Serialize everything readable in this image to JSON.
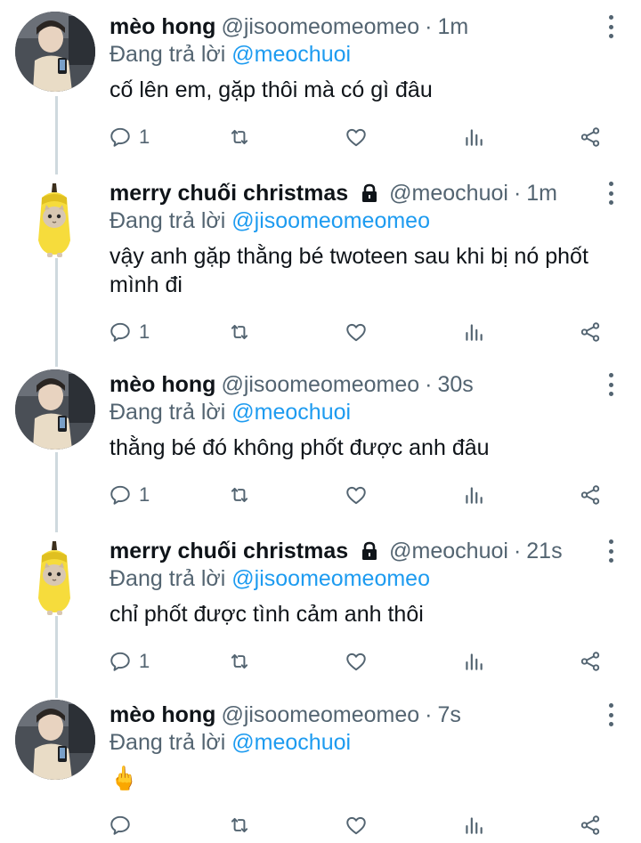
{
  "replying_prefix": "Đang trả lời ",
  "tweets": [
    {
      "name": "mèo hong",
      "handle": "@jisoomeomeomeo",
      "separator": "·",
      "time": "1m",
      "reply_to": "@meochuoi",
      "text": "cố lên em, gặp thôi mà có gì đâu",
      "reply_count": "1",
      "avatar": "person-photo",
      "locked": false
    },
    {
      "name": "merry chuối christmas",
      "handle": "@meochuoi",
      "separator": "·",
      "time": "1m",
      "reply_to": "@jisoomeomeomeo",
      "text": "vậy anh gặp thằng bé twoteen sau khi bị nó phốt mình đi",
      "reply_count": "1",
      "avatar": "banana-cat",
      "locked": true
    },
    {
      "name": "mèo hong",
      "handle": "@jisoomeomeomeo",
      "separator": "·",
      "time": "30s",
      "reply_to": "@meochuoi",
      "text": "thằng bé đó không phốt được anh đâu",
      "reply_count": "1",
      "avatar": "person-photo",
      "locked": false
    },
    {
      "name": "merry chuối christmas",
      "handle": "@meochuoi",
      "separator": "·",
      "time": "21s",
      "reply_to": "@jisoomeomeomeo",
      "text": "chỉ phốt được tình cảm anh thôi",
      "reply_count": "1",
      "avatar": "banana-cat",
      "locked": true
    },
    {
      "name": "mèo hong",
      "handle": "@jisoomeomeomeo",
      "separator": "·",
      "time": "7s",
      "reply_to": "@meochuoi",
      "text": "🖕",
      "reply_count": "",
      "avatar": "person-photo",
      "locked": false
    }
  ],
  "icons": {
    "reply": "reply-icon",
    "retweet": "retweet-icon",
    "like": "heart-icon",
    "analytics": "analytics-icon",
    "share": "share-icon",
    "more": "more-vertical-icon",
    "lock": "lock-icon"
  },
  "colors": {
    "text": "#0f1419",
    "secondary": "#536471",
    "link": "#1d9bf0",
    "thread_line": "#cfd9de"
  }
}
